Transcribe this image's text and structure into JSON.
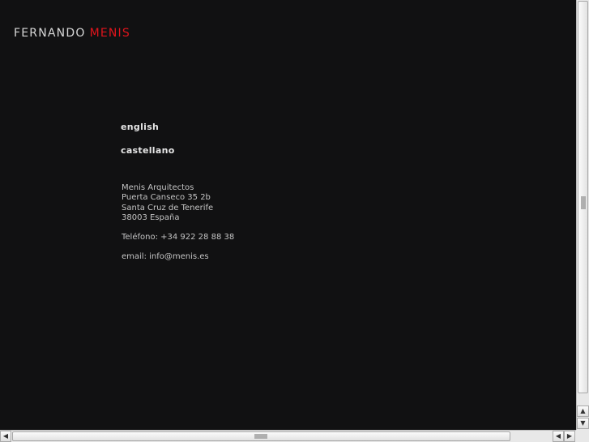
{
  "brand": {
    "first_name": "FERNANDO",
    "last_name": "MENIS",
    "first_color": "#d8d8d8",
    "last_color": "#e0141c"
  },
  "languages": [
    {
      "label": "english"
    },
    {
      "label": "castellano"
    }
  ],
  "contact": {
    "company": "Menis Arquitectos",
    "street": "Puerta Canseco 35 2b",
    "city": "Santa Cruz de Tenerife",
    "postal": "38003 España",
    "phone": "Teléfono: +34 922 28 88 38",
    "email": "email: info@menis.es"
  },
  "scrollbars": {
    "up_icon": "▲",
    "down_icon": "▼",
    "left_icon": "◀",
    "right_icon": "▶"
  }
}
